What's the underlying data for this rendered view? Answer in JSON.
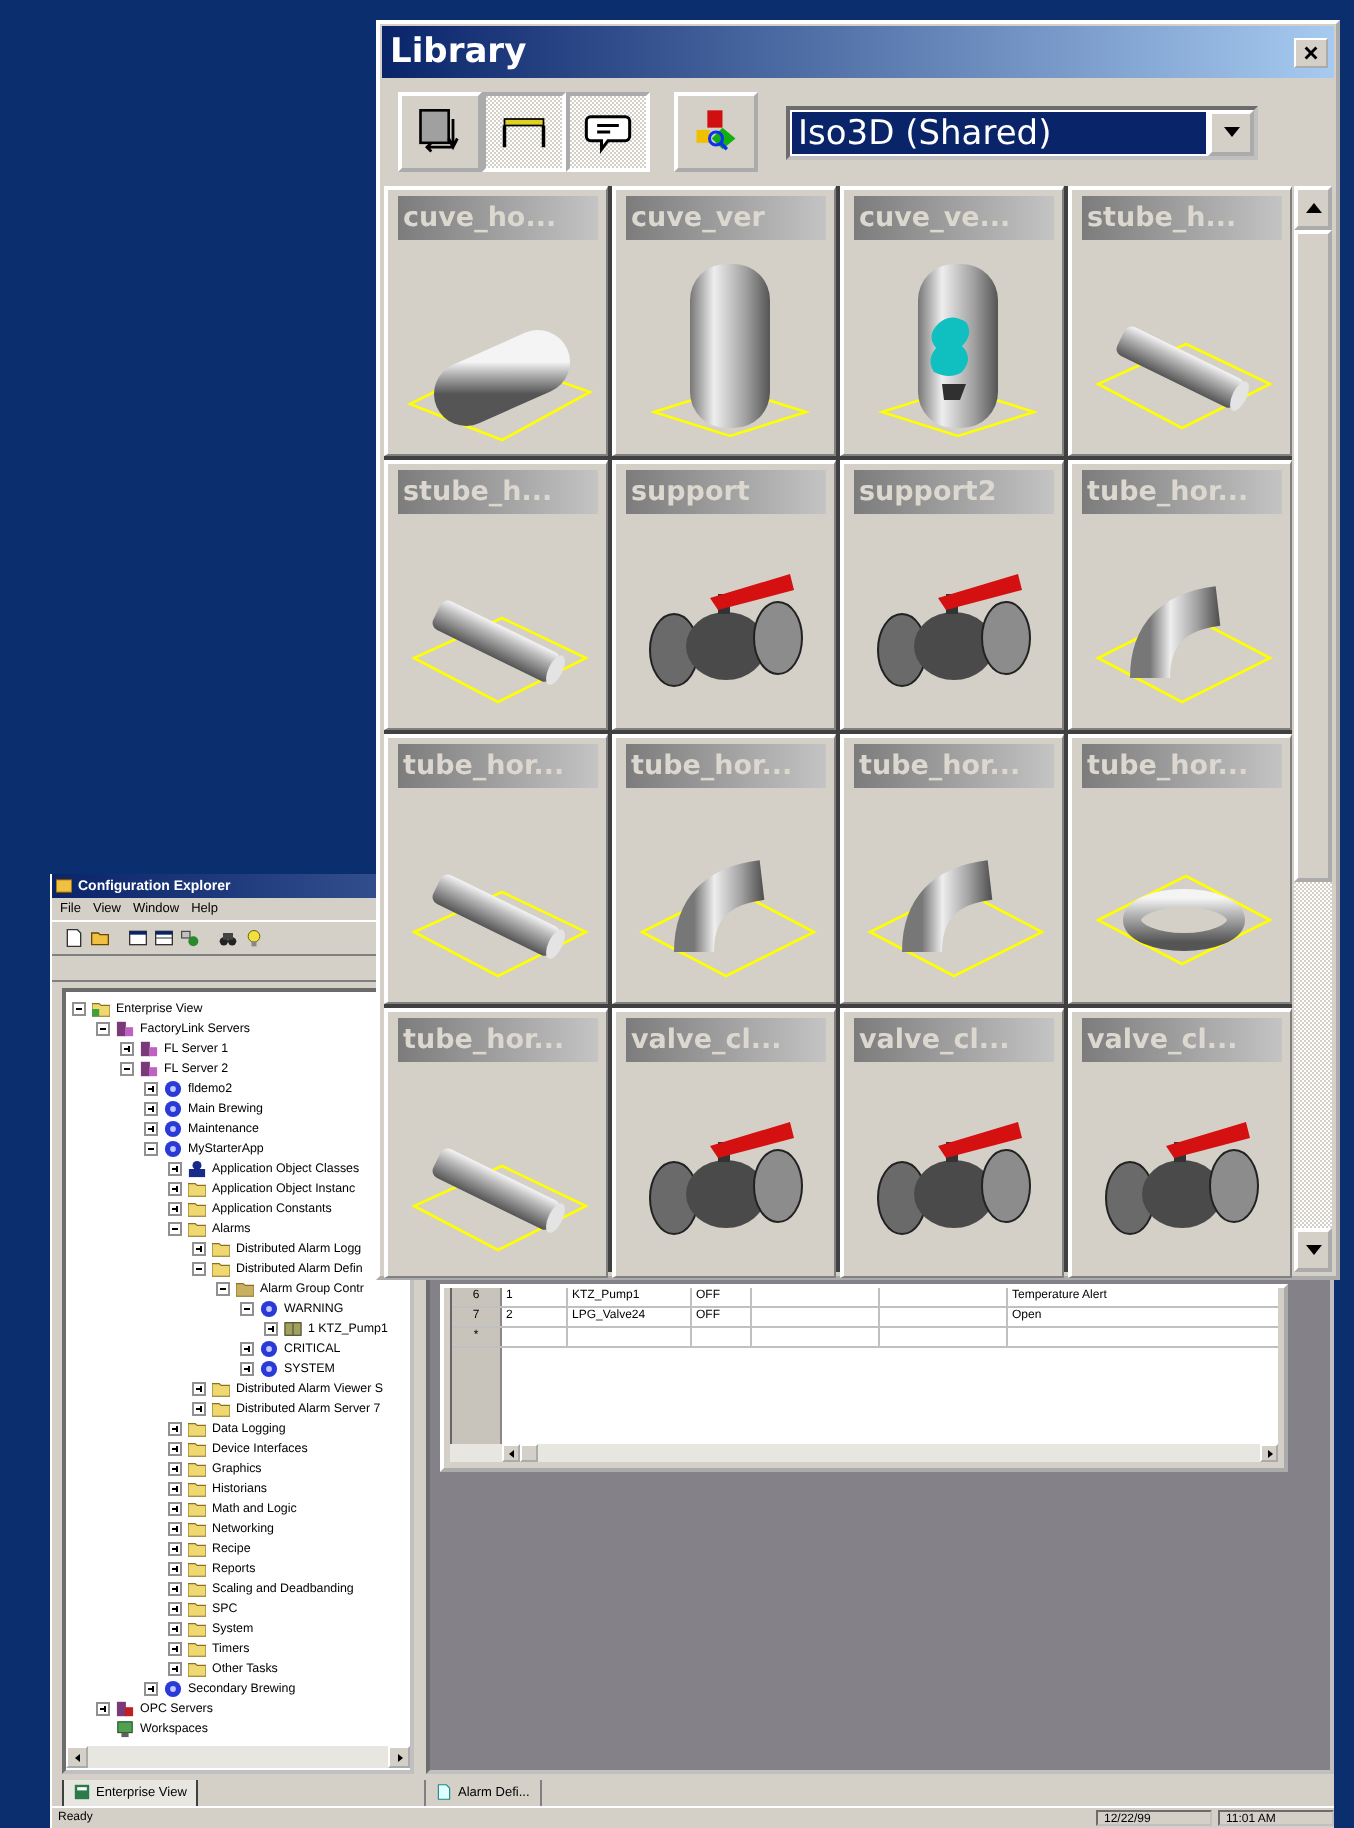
{
  "explorer": {
    "title": "Configuration Explorer",
    "menu": [
      "File",
      "View",
      "Window",
      "Help"
    ],
    "tree": [
      {
        "label": "Enterprise View",
        "kind": "view",
        "expanded": true,
        "children": [
          {
            "label": "FactoryLink Servers",
            "kind": "server",
            "expanded": true,
            "children": [
              {
                "label": "FL Server 1",
                "kind": "server",
                "expanded": false
              },
              {
                "label": "FL Server 2",
                "kind": "server",
                "expanded": true,
                "children": [
                  {
                    "label": "fldemo2",
                    "kind": "app",
                    "expanded": false
                  },
                  {
                    "label": "Main Brewing",
                    "kind": "app",
                    "expanded": false
                  },
                  {
                    "label": "Maintenance",
                    "kind": "app",
                    "expanded": false
                  },
                  {
                    "label": "MyStarterApp",
                    "kind": "app",
                    "expanded": true,
                    "children": [
                      {
                        "label": "Application Object Classes",
                        "kind": "classes",
                        "expanded": false
                      },
                      {
                        "label": "Application Object Instanc",
                        "kind": "folder",
                        "expanded": false
                      },
                      {
                        "label": "Application Constants",
                        "kind": "folder",
                        "expanded": false
                      },
                      {
                        "label": "Alarms",
                        "kind": "folder",
                        "expanded": true,
                        "children": [
                          {
                            "label": "Distributed Alarm Logg",
                            "kind": "folder",
                            "expanded": false
                          },
                          {
                            "label": "Distributed Alarm Defin",
                            "kind": "folder",
                            "expanded": true,
                            "children": [
                              {
                                "label": "Alarm Group Contr",
                                "kind": "group",
                                "expanded": true,
                                "children": [
                                  {
                                    "label": "WARNING",
                                    "kind": "app",
                                    "expanded": true,
                                    "children": [
                                      {
                                        "label": "1 KTZ_Pump1",
                                        "kind": "tag",
                                        "expanded": false
                                      }
                                    ]
                                  },
                                  {
                                    "label": "CRITICAL",
                                    "kind": "app",
                                    "expanded": false
                                  },
                                  {
                                    "label": "SYSTEM",
                                    "kind": "app",
                                    "expanded": false
                                  }
                                ]
                              }
                            ]
                          },
                          {
                            "label": "Distributed Alarm Viewer S",
                            "kind": "folder",
                            "expanded": false
                          },
                          {
                            "label": "Distributed Alarm Server 7",
                            "kind": "folder",
                            "expanded": false
                          }
                        ]
                      },
                      {
                        "label": "Data Logging",
                        "kind": "folder",
                        "expanded": false
                      },
                      {
                        "label": "Device Interfaces",
                        "kind": "folder",
                        "expanded": false
                      },
                      {
                        "label": "Graphics",
                        "kind": "folder",
                        "expanded": false
                      },
                      {
                        "label": "Historians",
                        "kind": "folder",
                        "expanded": false
                      },
                      {
                        "label": "Math and Logic",
                        "kind": "folder",
                        "expanded": false
                      },
                      {
                        "label": "Networking",
                        "kind": "folder",
                        "expanded": false
                      },
                      {
                        "label": "Recipe",
                        "kind": "folder",
                        "expanded": false
                      },
                      {
                        "label": "Reports",
                        "kind": "folder",
                        "expanded": false
                      },
                      {
                        "label": "Scaling and Deadbanding",
                        "kind": "folder",
                        "expanded": false
                      },
                      {
                        "label": "SPC",
                        "kind": "folder",
                        "expanded": false
                      },
                      {
                        "label": "System",
                        "kind": "folder",
                        "expanded": false
                      },
                      {
                        "label": "Timers",
                        "kind": "folder",
                        "expanded": false
                      },
                      {
                        "label": "Other Tasks",
                        "kind": "folder",
                        "expanded": false
                      }
                    ]
                  },
                  {
                    "label": "Secondary Brewing",
                    "kind": "app",
                    "expanded": false
                  }
                ]
              }
            ]
          },
          {
            "label": "OPC Servers",
            "kind": "opc",
            "expanded": false
          },
          {
            "label": "Workspaces",
            "kind": "workspace"
          }
        ]
      }
    ],
    "grid": {
      "rows": [
        {
          "row_header": "6",
          "column_1": "1",
          "column_2": "KTZ_Pump1",
          "column_3": "OFF",
          "column_6": "Temperature Alert"
        },
        {
          "row_header": "7",
          "column_1": "2",
          "column_2": "LPG_Valve24",
          "column_3": "OFF",
          "column_6": "Open"
        }
      ],
      "new_row_marker": "*"
    },
    "tabs": [
      {
        "label": "Enterprise View",
        "selected": true
      }
    ],
    "document_tabs": [
      {
        "label": "Alarm Defi..."
      }
    ],
    "status_bar": {
      "text": "Ready",
      "date": "12/22/99",
      "time": "11:01 AM"
    }
  },
  "library": {
    "title": "Library",
    "toolbar": [
      {
        "kind": "palette",
        "pressed": false
      },
      {
        "kind": "frame",
        "pressed": true
      },
      {
        "kind": "callout",
        "pressed": true
      }
    ],
    "style_dropdown": {
      "value": "Iso3D (Shared)"
    },
    "items": [
      {
        "label": "cuve_ho...",
        "kind": "tank_h"
      },
      {
        "label": "cuve_ver",
        "kind": "tank_v"
      },
      {
        "label": "cuve_ve...",
        "kind": "tank_cut"
      },
      {
        "label": "stube_h...",
        "kind": "pipe"
      },
      {
        "label": "stube_h...",
        "kind": "pipe"
      },
      {
        "label": "support",
        "kind": "valve"
      },
      {
        "label": "support2",
        "kind": "valve"
      },
      {
        "label": "tube_hor...",
        "kind": "elbow"
      },
      {
        "label": "tube_hor...",
        "kind": "pipe"
      },
      {
        "label": "tube_hor...",
        "kind": "elbow"
      },
      {
        "label": "tube_hor...",
        "kind": "elbow"
      },
      {
        "label": "tube_hor...",
        "kind": "ring"
      },
      {
        "label": "tube_hor...",
        "kind": "pipe"
      },
      {
        "label": "valve_cl...",
        "kind": "valve"
      },
      {
        "label": "valve_cl...",
        "kind": "valve"
      },
      {
        "label": "valve_cl...",
        "kind": "valve"
      }
    ]
  }
}
